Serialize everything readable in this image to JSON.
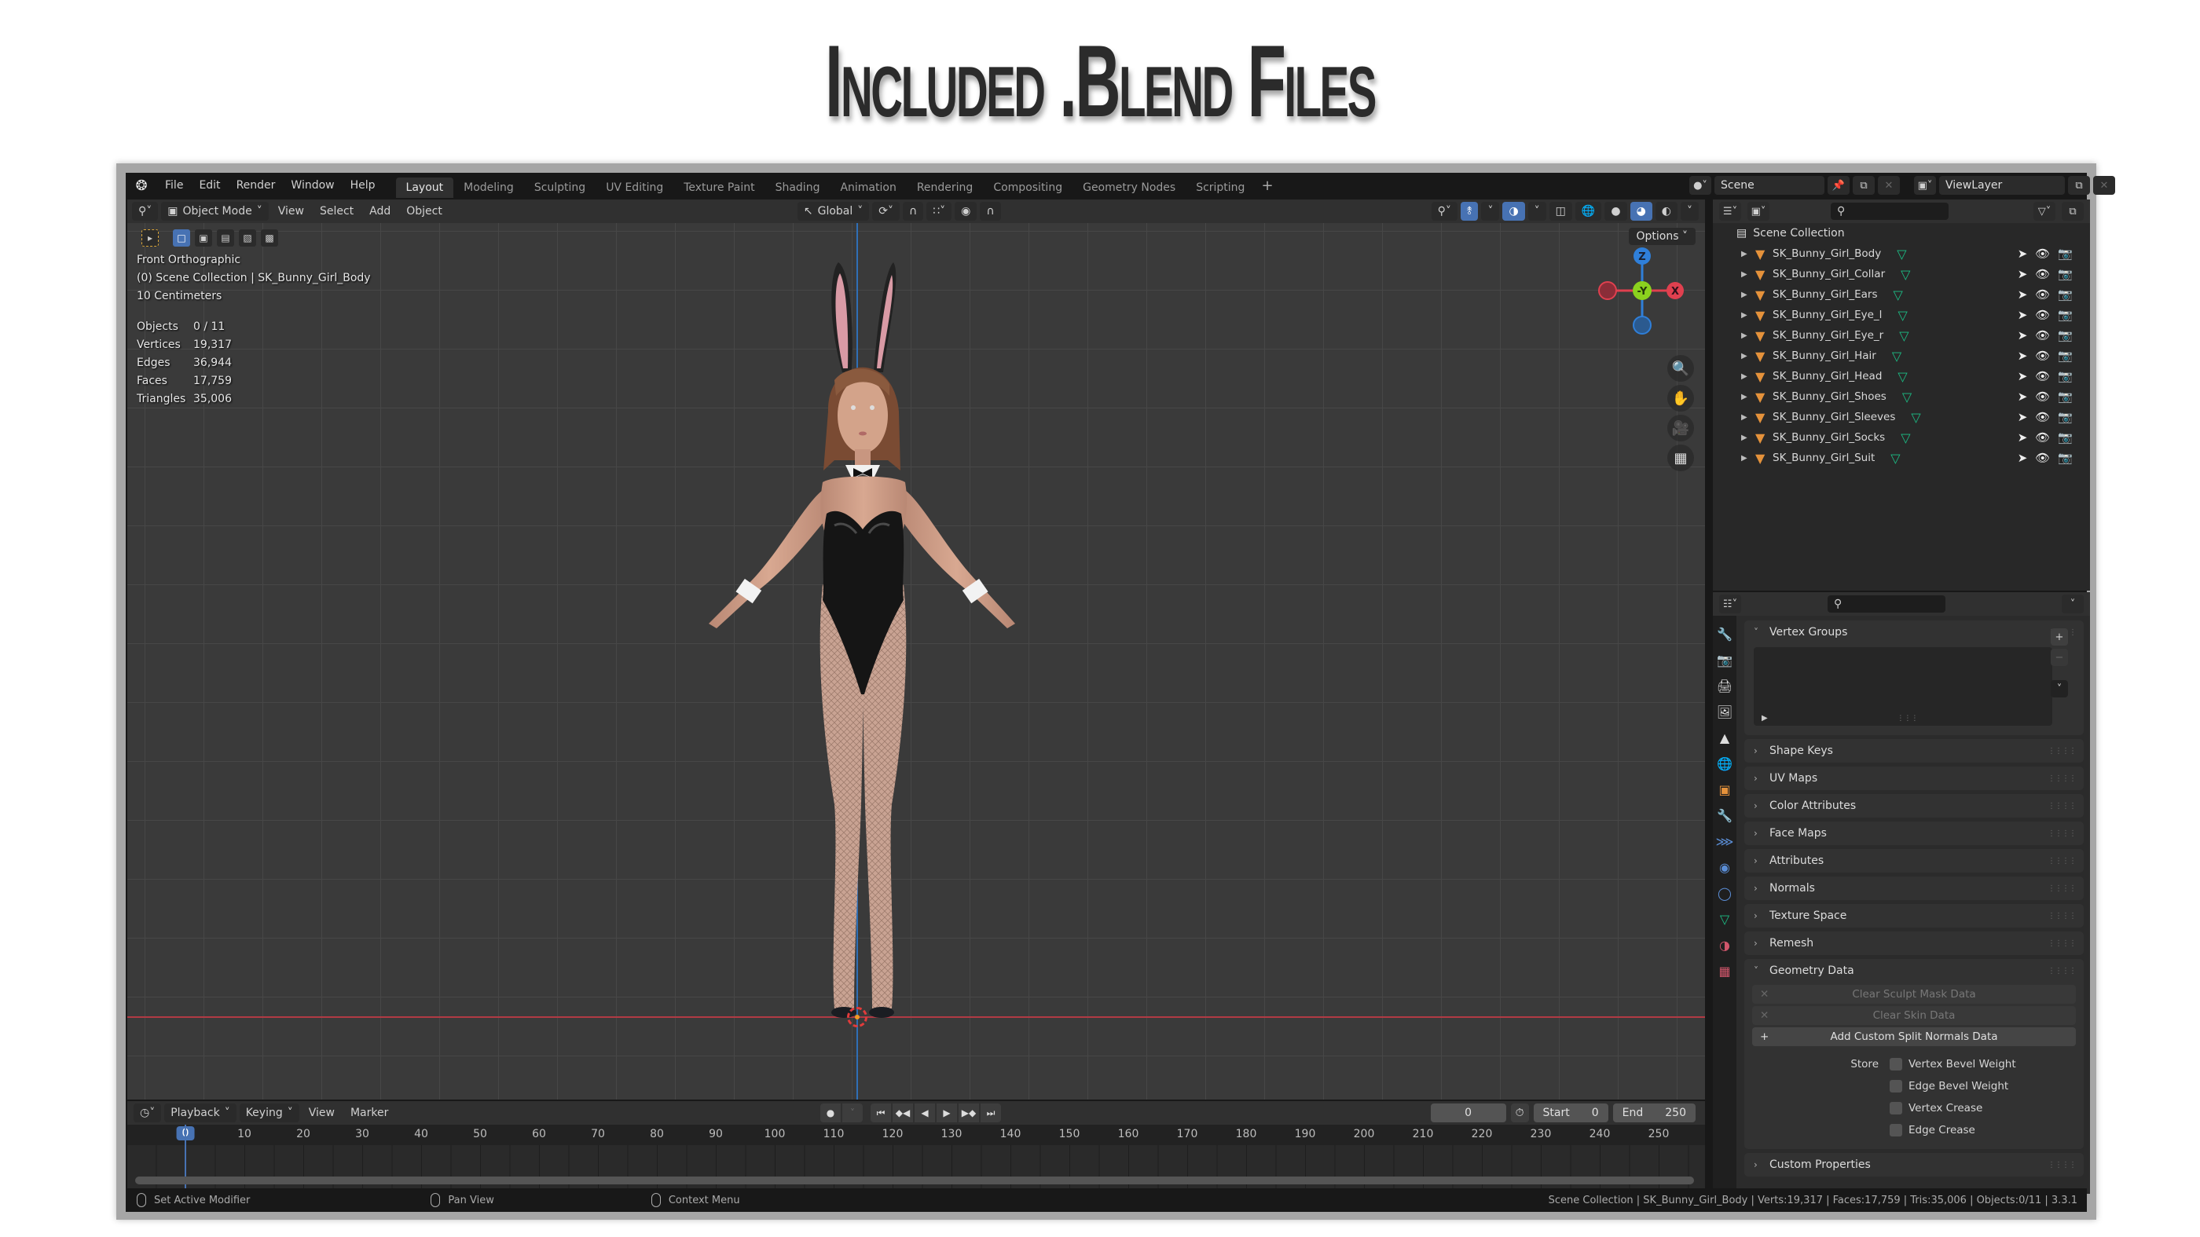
{
  "page_title": "Included .Blend Files",
  "topbar": {
    "logo": "blender-logo",
    "menus": [
      "File",
      "Edit",
      "Render",
      "Window",
      "Help"
    ],
    "workspaces": [
      "Layout",
      "Modeling",
      "Sculpting",
      "UV Editing",
      "Texture Paint",
      "Shading",
      "Animation",
      "Rendering",
      "Compositing",
      "Geometry Nodes",
      "Scripting"
    ],
    "active_workspace": "Layout",
    "add_workspace": "+",
    "scene": "Scene",
    "view_layer": "ViewLayer"
  },
  "viewport": {
    "mode": "Object Mode",
    "menus": [
      "View",
      "Select",
      "Add",
      "Object"
    ],
    "transform_orientation": "Global",
    "options_label": "Options",
    "overlay": {
      "view_name": "Front Orthographic",
      "collection_line": "(0) Scene Collection | SK_Bunny_Girl_Body",
      "grid_scale": "10 Centimeters"
    },
    "stats": [
      {
        "label": "Objects",
        "value": "0 / 11"
      },
      {
        "label": "Vertices",
        "value": "19,317"
      },
      {
        "label": "Edges",
        "value": "36,944"
      },
      {
        "label": "Faces",
        "value": "17,759"
      },
      {
        "label": "Triangles",
        "value": "35,006"
      }
    ],
    "gizmo": {
      "z": "Z",
      "y": "-Y",
      "x": "X"
    },
    "colors": {
      "x_axis": "#e0404f",
      "y_axis": "#8bd11e",
      "z_axis": "#2f7fd9",
      "accent": "#4772b3"
    }
  },
  "timeline": {
    "menus": [
      "Playback",
      "Keying",
      "View",
      "Marker"
    ],
    "current_frame": "0",
    "start_label": "Start",
    "start": "0",
    "end_label": "End",
    "end": "250",
    "ticks": [
      "0",
      "10",
      "20",
      "30",
      "40",
      "50",
      "60",
      "70",
      "80",
      "90",
      "100",
      "110",
      "120",
      "130",
      "140",
      "150",
      "160",
      "170",
      "180",
      "190",
      "200",
      "210",
      "220",
      "230",
      "240",
      "250"
    ]
  },
  "outliner": {
    "root": "Scene Collection",
    "objects": [
      "SK_Bunny_Girl_Body",
      "SK_Bunny_Girl_Collar",
      "SK_Bunny_Girl_Ears",
      "SK_Bunny_Girl_Eye_l",
      "SK_Bunny_Girl_Eye_r",
      "SK_Bunny_Girl_Hair",
      "SK_Bunny_Girl_Head",
      "SK_Bunny_Girl_Shoes",
      "SK_Bunny_Girl_Sleeves",
      "SK_Bunny_Girl_Socks",
      "SK_Bunny_Girl_Suit"
    ]
  },
  "properties": {
    "panels_top": {
      "vertex_groups": "Vertex Groups"
    },
    "collapsed_panels": [
      "Shape Keys",
      "UV Maps",
      "Color Attributes",
      "Face Maps",
      "Attributes",
      "Normals",
      "Texture Space",
      "Remesh"
    ],
    "geometry_data": {
      "title": "Geometry Data",
      "clear_sculpt_mask": "Clear Sculpt Mask Data",
      "clear_skin": "Clear Skin Data",
      "add_custom_split_normals": "Add Custom Split Normals Data",
      "store_label": "Store",
      "store_options": [
        {
          "label": "Vertex Bevel Weight",
          "checked": false
        },
        {
          "label": "Edge Bevel Weight",
          "checked": false
        },
        {
          "label": "Vertex Crease",
          "checked": false
        },
        {
          "label": "Edge Crease",
          "checked": false
        }
      ]
    },
    "custom_properties": "Custom Properties"
  },
  "statusbar": {
    "left_hint": "Set Active Modifier",
    "middle_hint": "Pan View",
    "right_hint": "Context Menu",
    "info": "Scene Collection | SK_Bunny_Girl_Body | Verts:19,317 | Faces:17,759 | Tris:35,006 | Objects:0/11 | 3.3.1"
  }
}
